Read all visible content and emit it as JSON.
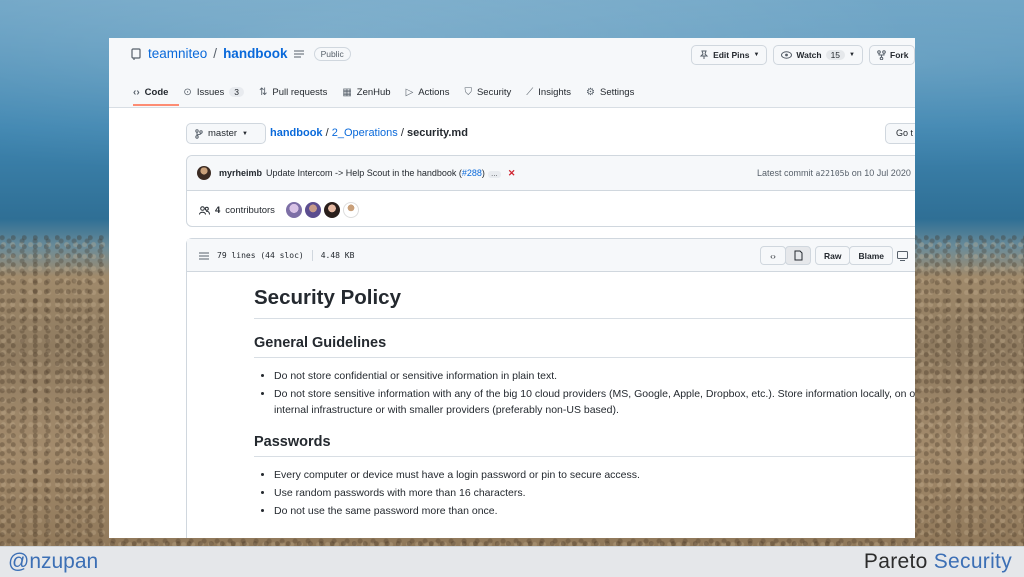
{
  "repo": {
    "owner": "teamniteo",
    "separator": "/",
    "name": "handbook",
    "visibility": "Public"
  },
  "header_actions": [
    {
      "icon": "pin-icon",
      "label": "Edit Pins"
    },
    {
      "icon": "eye-icon",
      "label": "Watch",
      "count": "15"
    },
    {
      "icon": "fork-icon",
      "label": "Fork"
    }
  ],
  "tabs": [
    {
      "icon": "code-icon",
      "label": "Code",
      "active": true
    },
    {
      "icon": "issue-icon",
      "label": "Issues",
      "count": "3"
    },
    {
      "icon": "pull-request-icon",
      "label": "Pull requests"
    },
    {
      "icon": "zenhub-icon",
      "label": "ZenHub"
    },
    {
      "icon": "play-icon",
      "label": "Actions"
    },
    {
      "icon": "shield-icon",
      "label": "Security"
    },
    {
      "icon": "graph-icon",
      "label": "Insights"
    },
    {
      "icon": "gear-icon",
      "label": "Settings"
    }
  ],
  "branch": "master",
  "breadcrumb": {
    "repo": "handbook",
    "folder": "2_Operations",
    "file": "security.md",
    "sep": "/"
  },
  "goto_label": "Go t",
  "commit": {
    "author": "myrheimb",
    "message": "Update Intercom -> Help Scout in the handbook (",
    "pr": "#288",
    "message_end": ")",
    "ellipsis": "…",
    "status": "✕",
    "latest_prefix": "Latest commit",
    "sha": "a22105b",
    "date": "on 10 Jul 2020"
  },
  "contributors": {
    "count": "4",
    "label": "contributors"
  },
  "file": {
    "lines": "79 lines (44 sloc)",
    "size": "4.48 KB"
  },
  "file_tools": {
    "raw": "Raw",
    "blame": "Blame"
  },
  "content": {
    "h1": "Security Policy",
    "sections": [
      {
        "title": "General Guidelines",
        "items": [
          "Do not store confidential or sensitive information in plain text.",
          "Do not store sensitive information with any of the big 10 cloud providers (MS, Google, Apple, Dropbox, etc.). Store information locally, on our internal infrastructure or with smaller providers (preferably non-US based)."
        ]
      },
      {
        "title": "Passwords",
        "items": [
          "Every computer or device must have a login password or pin to secure access.",
          "Use random passwords with more than 16 characters.",
          "Do not use the same password more than once."
        ]
      }
    ]
  },
  "footer": {
    "handle": "@nzupan",
    "brand_a": "Pareto",
    "brand_b": "Security"
  }
}
